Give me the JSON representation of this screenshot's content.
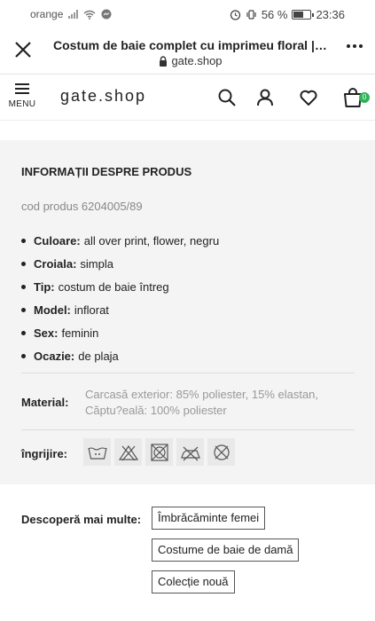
{
  "status_bar": {
    "carrier": "orange",
    "battery": "56 %",
    "time": "23:36"
  },
  "browser": {
    "title": "Costum de baie complet cu imprimeu floral | GATE",
    "url": "gate.shop"
  },
  "site_nav": {
    "menu_label": "MENU",
    "logo": "gate.shop",
    "cart_count": "0",
    "accent_color": "#2fb35a"
  },
  "product_info": {
    "heading": "INFORMAȚII DESPRE PRODUS",
    "code": "cod produs 6204005/89",
    "attributes": [
      {
        "key": "Culoare:",
        "value": "all over print, flower, negru"
      },
      {
        "key": "Croiala:",
        "value": "simpla"
      },
      {
        "key": "Tip:",
        "value": "costum de baie întreg"
      },
      {
        "key": "Model:",
        "value": "inflorat"
      },
      {
        "key": "Sex:",
        "value": "feminin"
      },
      {
        "key": "Ocazie:",
        "value": "de plaja"
      }
    ],
    "material_label": "Material:",
    "material_lines": [
      "Carcasă exterior: 85% poliester, 15% elastan,",
      "Căptu?eală: 100% poliester"
    ],
    "care_label": "îngrijire:",
    "care_icons": [
      "wash-30-icon",
      "no-bleach-icon",
      "no-tumble-dry-icon",
      "no-iron-icon",
      "no-dry-clean-icon"
    ]
  },
  "discover": {
    "label": "Descoperă mai multe:",
    "tags": [
      "Îmbrăcăminte femei",
      "Costume de baie de damă",
      "Colecție nouă"
    ]
  }
}
